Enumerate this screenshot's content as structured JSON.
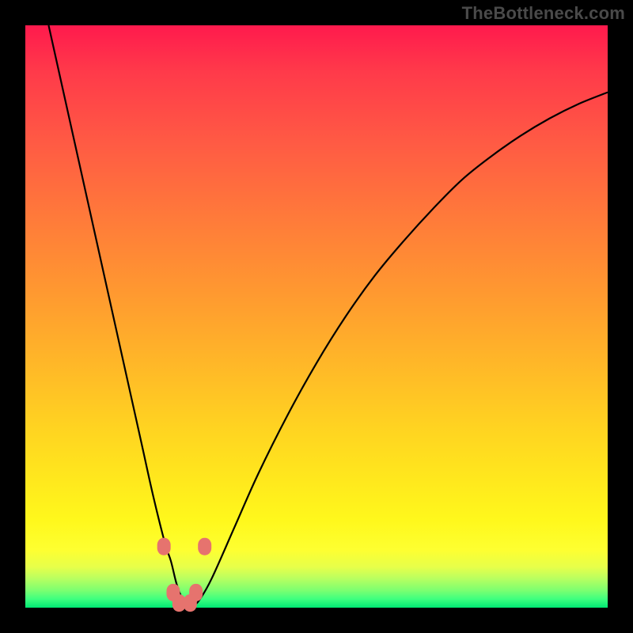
{
  "watermark": "TheBottleneck.com",
  "colors": {
    "frame": "#000000",
    "curve": "#000000",
    "marker": "#e6736e"
  },
  "chart_data": {
    "type": "line",
    "title": "",
    "xlabel": "",
    "ylabel": "",
    "xlim": [
      0,
      100
    ],
    "ylim": [
      0,
      100
    ],
    "grid": false,
    "legend": false,
    "series": [
      {
        "name": "bottleneck-curve",
        "x": [
          4,
          8,
          12,
          16,
          18,
          20,
          22,
          24,
          25,
          26,
          27,
          28,
          29,
          30,
          32,
          36,
          40,
          45,
          50,
          55,
          60,
          65,
          70,
          75,
          80,
          85,
          90,
          95,
          100
        ],
        "y": [
          100,
          82,
          64,
          46,
          37,
          28,
          19,
          11,
          8,
          4,
          1.5,
          0.5,
          0.5,
          1.5,
          5,
          14,
          23,
          33,
          42,
          50,
          57,
          63,
          68.5,
          73.5,
          77.5,
          81,
          84,
          86.5,
          88.5
        ]
      }
    ],
    "markers": [
      {
        "x": 23.8,
        "y": 10.5
      },
      {
        "x": 30.8,
        "y": 10.5
      },
      {
        "x": 25.4,
        "y": 2.6
      },
      {
        "x": 29.3,
        "y": 2.6
      },
      {
        "x": 26.4,
        "y": 0.8
      },
      {
        "x": 28.3,
        "y": 0.8
      }
    ],
    "minimum": {
      "x": 27.3,
      "y": 0.3
    }
  }
}
